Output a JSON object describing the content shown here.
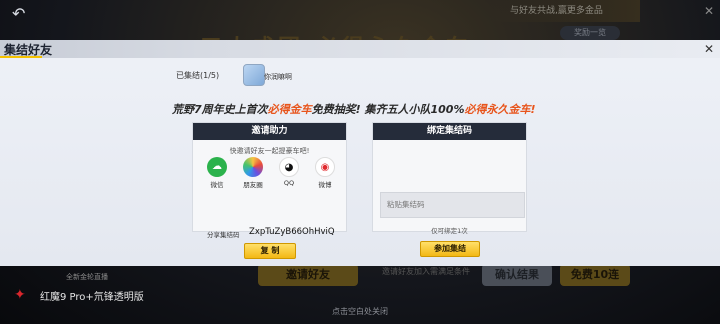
{
  "background": {
    "banner": "五人成团 必得永久金车",
    "ticker": "与好友共战,赢更多金品",
    "mini_button": "奖励一览",
    "invite_button": "邀请好友",
    "confirm_button": "确认结果",
    "free_button": "免费10连",
    "small_text": "邀请好友加入需满足条件",
    "left_small": "全新金轮直播"
  },
  "modal": {
    "title": "集结好友",
    "gathered": "已集结(1/5)",
    "avatar_name": "你润嘛啊",
    "headline_prefix": "荒野7周年史上首次",
    "headline_hl1": "必得金车",
    "headline_mid": "免费抽奖! 集齐五人小队100%",
    "headline_hl2": "必得永久金车!",
    "invite": {
      "header": "邀请助力",
      "tip": "快邀请好友一起提豪车吧!",
      "share": [
        {
          "label": "微信",
          "icon": "wechat-icon"
        },
        {
          "label": "朋友圈",
          "icon": "moments-icon"
        },
        {
          "label": "QQ",
          "icon": "qq-icon"
        },
        {
          "label": "微博",
          "icon": "weibo-icon"
        }
      ],
      "code_label": "分享集结码",
      "code_value": "ZxpTuZyB66OhHviQ",
      "copy_button": "复 制"
    },
    "bind": {
      "header": "绑定集结码",
      "placeholder": "粘贴集结码",
      "note": "仅可绑定1次",
      "join_button": "参加集结"
    }
  },
  "footer": {
    "tap_close": "点击空白处关闭",
    "brand": "红魔9 Pro+氘锋透明版"
  },
  "colors": {
    "accent": "#f5c200",
    "highlight": "#e8541b",
    "panel_header": "#252c3a"
  }
}
